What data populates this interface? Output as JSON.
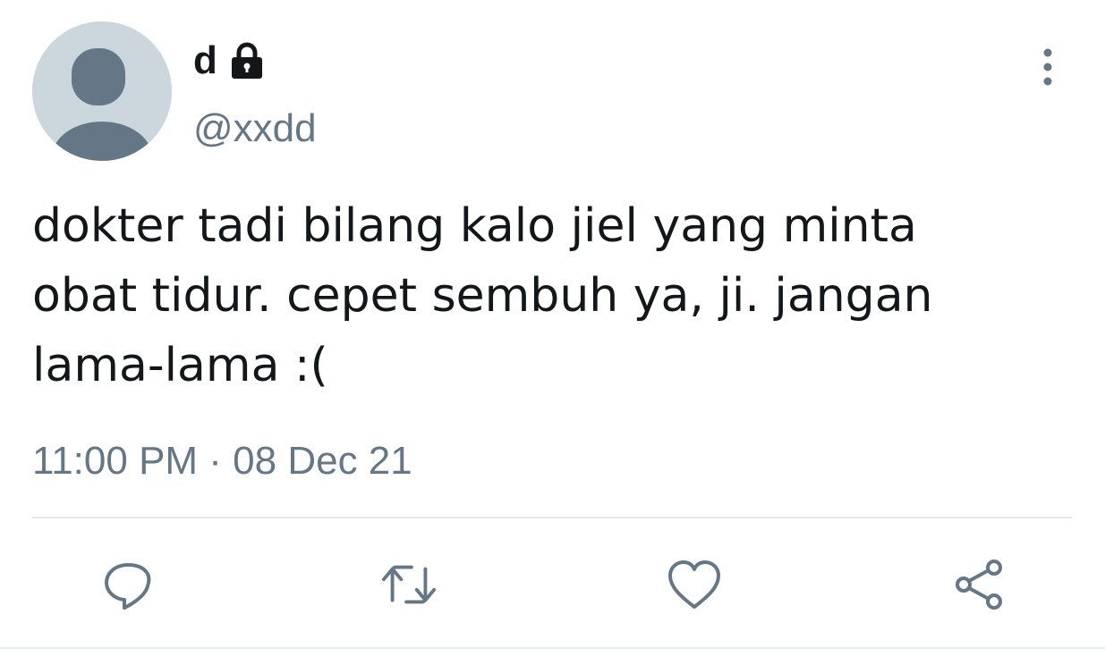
{
  "tweet": {
    "display_name": "d",
    "handle": "@xxdd",
    "text": "dokter tadi bilang kalo jiel yang minta\nobat tidur. cepet sembuh ya, ji. jangan\nlama-lama :(",
    "timestamp": "11:00 PM · 08 Dec 21"
  },
  "icons": {
    "account": "lock-icon",
    "menu": "more-vertical-icon",
    "actions": [
      "reply-icon",
      "retweet-icon",
      "like-icon",
      "share-icon"
    ]
  },
  "colors": {
    "text": "#14171a",
    "secondary": "#657786",
    "avatar_bg": "#ccd6dd",
    "avatar_fg": "#657786",
    "divider": "#e1e8ed"
  }
}
